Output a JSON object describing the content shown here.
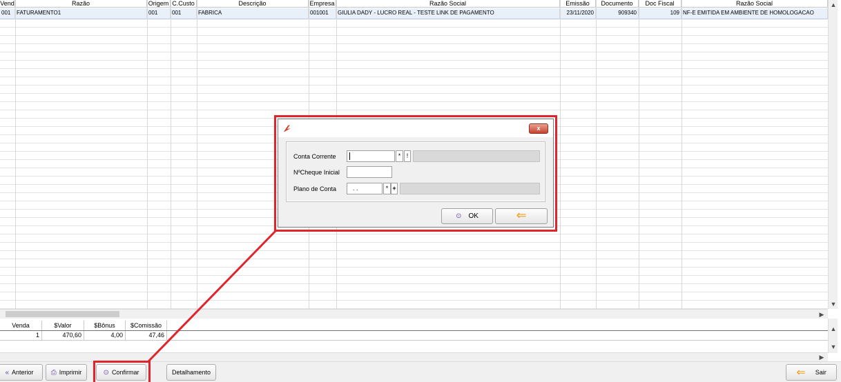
{
  "grid": {
    "columns": [
      "Vend",
      "Razão",
      "Origem",
      "C.Custo",
      "Descrição",
      "Empresa",
      "Razão Social",
      "Emissão",
      "Documento",
      "Doc Fiscal",
      "Razão Social"
    ],
    "row": [
      "001",
      "FATURAMENTO1",
      "001",
      "001",
      "FABRICA",
      "001001",
      "GIULIA DADY - LUCRO REAL - TESTE LINK DE PAGAMENTO",
      "23/11/2020",
      "909340",
      "109",
      "NF-E EMITIDA EM AMBIENTE DE HOMOLOGACAO"
    ]
  },
  "summary": {
    "columns": [
      "Venda",
      "$Valor",
      "$Bônus",
      "$Comissão"
    ],
    "values": [
      "1",
      "470,60",
      "4,00",
      "47,46"
    ]
  },
  "toolbar": {
    "anterior_label": "Anterior",
    "imprimir_label": "Imprimir",
    "confirmar_label": "Confirmar",
    "detalhamento_label": "Detalhamento",
    "sair_label": "Sair"
  },
  "dialog": {
    "close_label": "x",
    "conta_corrente_label": "Conta Corrente",
    "conta_corrente_value": "",
    "cheque_inicial_label": "NºCheque Inicial",
    "cheque_inicial_value": "",
    "plano_conta_label": "Plano de Conta",
    "plano_conta_value": ". .",
    "ok_label": "OK",
    "search_symbol": "*",
    "add_symbol": "+",
    "info_symbol": "!"
  },
  "colors": {
    "highlight": "#e0242b",
    "selected_row": "#e8f0fa",
    "back_arrow": "#f0a020"
  }
}
